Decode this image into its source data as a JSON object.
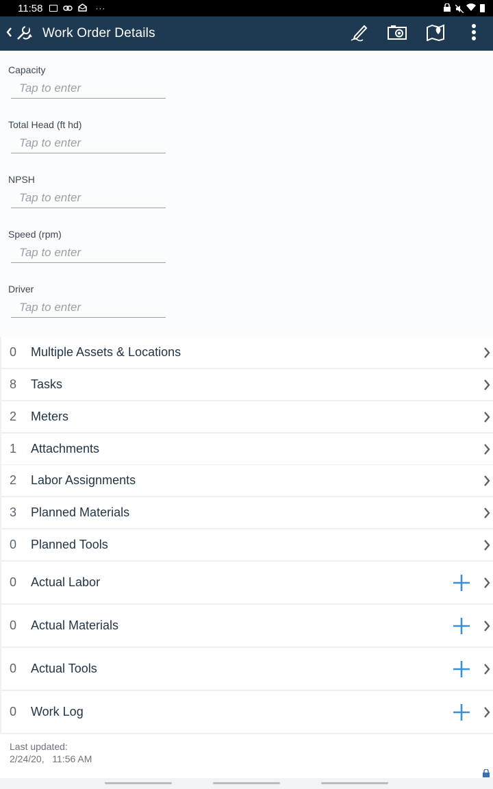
{
  "status_bar": {
    "time": "11:58",
    "dots": "···",
    "icons": [
      "image-icon",
      "link-icon",
      "mail-icon",
      "lock-icon",
      "mute-icon",
      "wifi-icon",
      "battery-icon"
    ]
  },
  "app_bar": {
    "title": "Work Order Details",
    "actions": [
      "pen-icon",
      "camera-icon",
      "map-icon",
      "more-vert-icon"
    ],
    "background": "#1e3a52"
  },
  "form": {
    "fields": [
      {
        "label": "Capacity",
        "placeholder": "Tap to enter",
        "value": ""
      },
      {
        "label": "Total Head (ft hd)",
        "placeholder": "Tap to enter",
        "value": ""
      },
      {
        "label": "NPSH",
        "placeholder": "Tap to enter",
        "value": ""
      },
      {
        "label": "Speed (rpm)",
        "placeholder": "Tap to enter",
        "value": ""
      },
      {
        "label": "Driver",
        "placeholder": "Tap to enter",
        "value": ""
      }
    ]
  },
  "list": {
    "items": [
      {
        "count": "0",
        "label": "Multiple Assets & Locations",
        "addable": false
      },
      {
        "count": "8",
        "label": "Tasks",
        "addable": false
      },
      {
        "count": "2",
        "label": "Meters",
        "addable": false
      },
      {
        "count": "1",
        "label": "Attachments",
        "addable": false
      },
      {
        "count": "2",
        "label": "Labor Assignments",
        "addable": false
      },
      {
        "count": "3",
        "label": "Planned Materials",
        "addable": false
      },
      {
        "count": "0",
        "label": "Planned Tools",
        "addable": false
      },
      {
        "count": "0",
        "label": "Actual Labor",
        "addable": true
      },
      {
        "count": "0",
        "label": "Actual Materials",
        "addable": true
      },
      {
        "count": "0",
        "label": "Actual Tools",
        "addable": true
      },
      {
        "count": "0",
        "label": "Work Log",
        "addable": true
      }
    ]
  },
  "footer": {
    "last_updated_label": "Last updated:",
    "last_updated_value": "2/24/20,   11:56 AM"
  },
  "colors": {
    "accent_plus": "#3a8fd6",
    "row_text": "#1f3447"
  }
}
